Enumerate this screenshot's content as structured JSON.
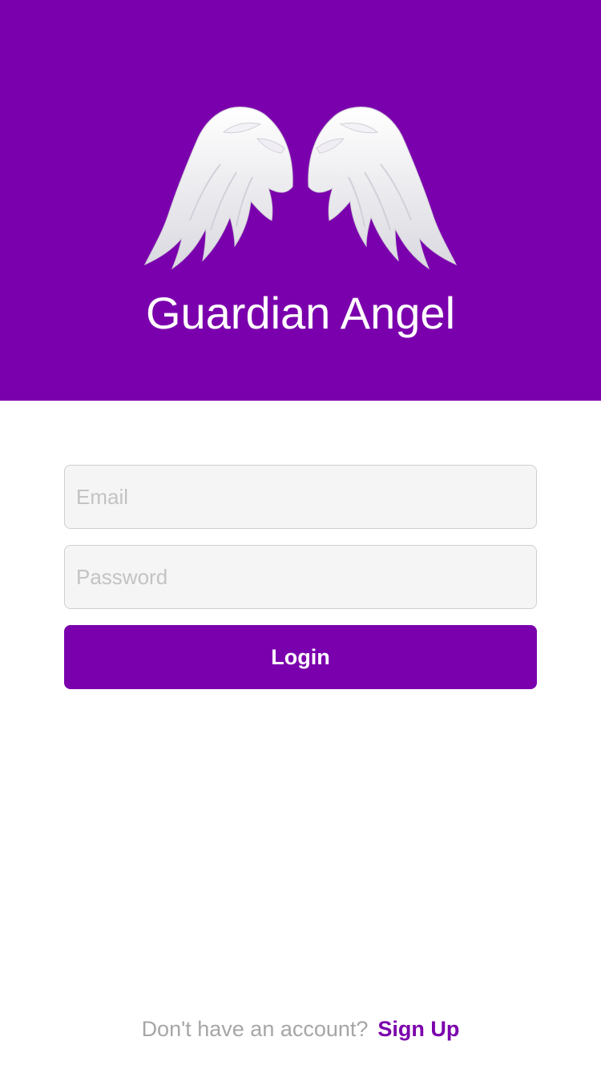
{
  "app": {
    "title": "Guardian Angel",
    "logo_icon": "angel-wings-icon"
  },
  "login_form": {
    "email_placeholder": "Email",
    "email_value": "",
    "password_placeholder": "Password",
    "password_value": "",
    "login_label": "Login"
  },
  "footer": {
    "prompt": "Don't have an account?",
    "signup_label": "Sign Up"
  },
  "colors": {
    "brand": "#7b00ad",
    "background": "#ffffff",
    "input_background": "#f5f5f5",
    "input_border": "#cfcfcf",
    "placeholder": "#c3c3c3",
    "muted_text": "#a6a6a6"
  }
}
